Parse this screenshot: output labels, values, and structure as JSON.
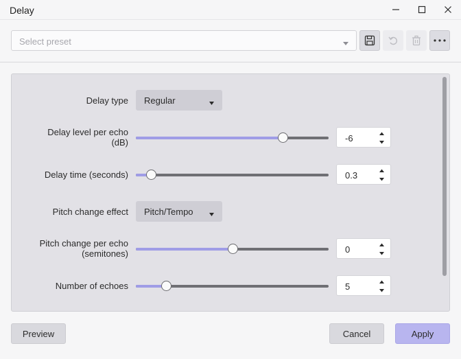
{
  "window": {
    "title": "Delay"
  },
  "preset": {
    "placeholder": "Select preset"
  },
  "toolbar": {
    "icons": [
      "save-icon",
      "undo-icon",
      "trash-icon",
      "more-icon"
    ]
  },
  "controls": {
    "delay_type": {
      "label": "Delay type",
      "value": "Regular"
    },
    "delay_level": {
      "label_line1": "Delay level per echo",
      "label_line2": "(dB)",
      "value": "-6",
      "slider_fraction": 0.76
    },
    "delay_time": {
      "label": "Delay time (seconds)",
      "value": "0.3",
      "slider_fraction": 0.08
    },
    "pitch_effect": {
      "label": "Pitch change effect",
      "value": "Pitch/Tempo"
    },
    "pitch_change": {
      "label_line1": "Pitch change per echo",
      "label_line2": "(semitones)",
      "value": "0",
      "slider_fraction": 0.5
    },
    "echoes": {
      "label": "Number of echoes",
      "value": "5",
      "slider_fraction": 0.155
    }
  },
  "footer": {
    "preview_label": "Preview",
    "cancel_label": "Cancel",
    "apply_label": "Apply"
  },
  "colors": {
    "accent": "#9f9ce6",
    "apply_button": "#b8b5ef",
    "panel": "#e2e1e6"
  }
}
